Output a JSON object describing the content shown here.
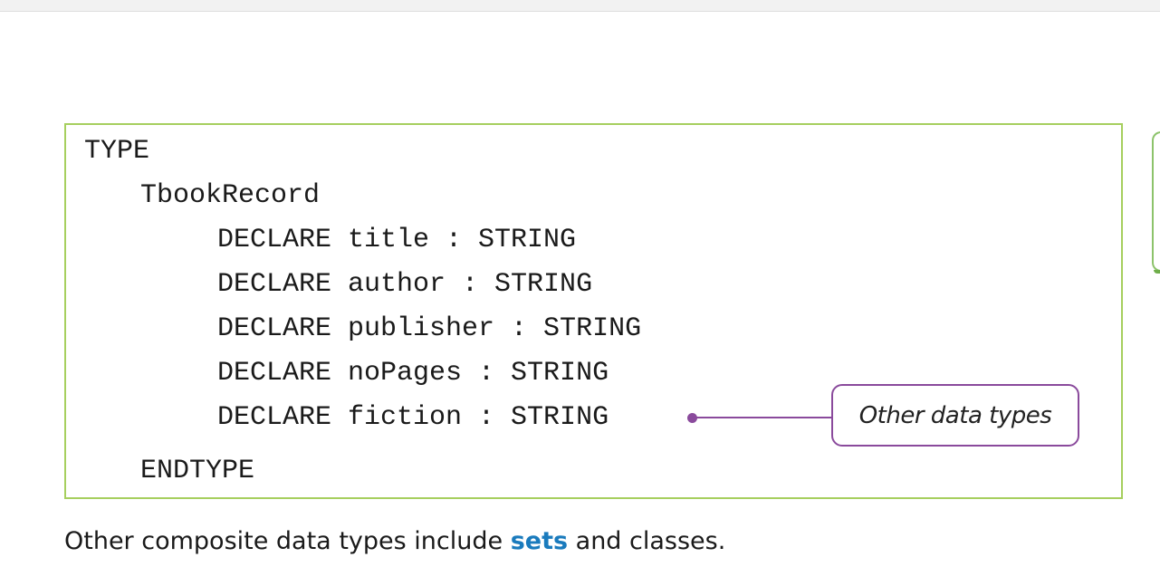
{
  "code": {
    "lines": [
      "TYPE",
      "TbookRecord",
      "DECLARE title : STRING",
      "DECLARE author : STRING",
      "DECLARE publisher : STRING",
      "DECLARE noPages : STRING",
      "DECLARE fiction : STRING",
      "ENDTYPE"
    ]
  },
  "callout": {
    "label": "Other data types"
  },
  "paragraph": {
    "before": "Other composite data types include ",
    "keyword": "sets",
    "after": " and classes."
  },
  "colors": {
    "code_border": "#a6cf5e",
    "callout": "#8a4a9c",
    "keyword": "#1a7bbd",
    "side_tab": "#8cc36b"
  }
}
